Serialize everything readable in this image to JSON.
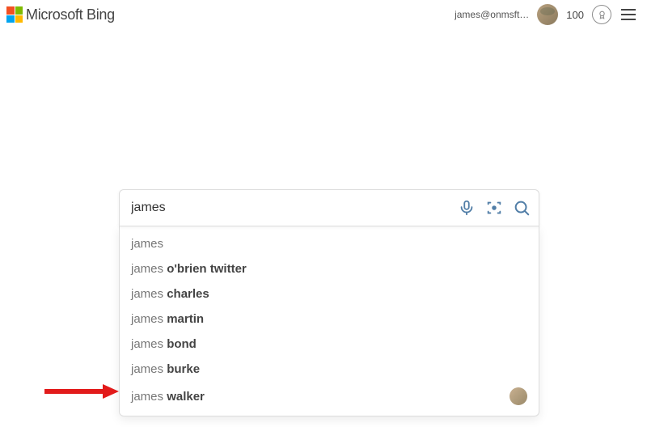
{
  "header": {
    "brand": "Microsoft Bing",
    "user_email": "james@onmsft…",
    "points": "100"
  },
  "search": {
    "value": "james"
  },
  "suggestions": [
    {
      "plain": "james",
      "bold": "",
      "has_avatar": false
    },
    {
      "plain": "james ",
      "bold": "o'brien twitter",
      "has_avatar": false
    },
    {
      "plain": "james ",
      "bold": "charles",
      "has_avatar": false
    },
    {
      "plain": "james ",
      "bold": "martin",
      "has_avatar": false
    },
    {
      "plain": "james ",
      "bold": "bond",
      "has_avatar": false
    },
    {
      "plain": "james ",
      "bold": "burke",
      "has_avatar": false
    },
    {
      "plain": "james ",
      "bold": "walker",
      "has_avatar": true
    }
  ]
}
